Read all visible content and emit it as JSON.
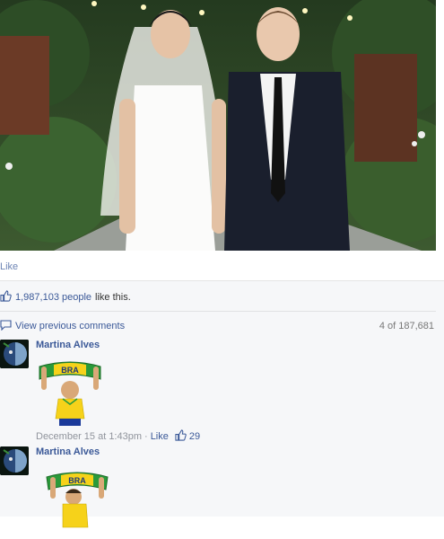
{
  "post": {
    "like_label": "Like"
  },
  "likes": {
    "count": "1,987,103 people",
    "suffix": "like this."
  },
  "comments_header": {
    "view_previous": "View previous comments",
    "pager": "4 of 187,681"
  },
  "comments": [
    {
      "author": "Martina Alves",
      "sticker_text": "BRA",
      "timestamp": "December 15 at 1:43pm",
      "separator": "·",
      "like_action": "Like",
      "like_count": "29"
    },
    {
      "author": "Martina Alves",
      "sticker_text": "BRA"
    }
  ],
  "icons": {
    "thumbs_up": "thumbs-up-icon",
    "comment": "comment-bubble-icon"
  },
  "colors": {
    "link_blue": "#3b5998",
    "light_link": "#6d84b4",
    "ufi_background": "#f6f7f9",
    "brazil_green": "#2a9a3a",
    "brazil_yellow": "#f6d21a"
  }
}
